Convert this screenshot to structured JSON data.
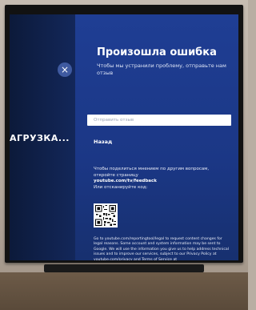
{
  "left": {
    "loading_text": "АГРУЗКА..."
  },
  "close_button": {
    "symbol": "×"
  },
  "dialog": {
    "title": "Произошла ошибка",
    "subtitle": "Чтобы мы устранили проблему, отправьте нам отзыв",
    "feedback_placeholder": "Отправить отзыв",
    "back_label": "Назад",
    "info_line1": "Чтобы поделиться мнением по другим вопросам, откройте страницу",
    "info_link": "youtube.com/tv/feedback",
    "info_line2": "Или отсканируйте код:",
    "legal_text": "Go to youtube.com/reportingtool/legal to request content changes for legal reasons. Some account and system information may be sent to Google. We will use the information you give us to help address technical issues and to improve our services, subject to our Privacy Policy at youtube.com/privacy and Terms of Service at"
  },
  "icons": {
    "close": "close-icon",
    "qr": "qr-code"
  },
  "colors": {
    "panel": "#1d3a8a",
    "accent": "#3f5aa0"
  }
}
